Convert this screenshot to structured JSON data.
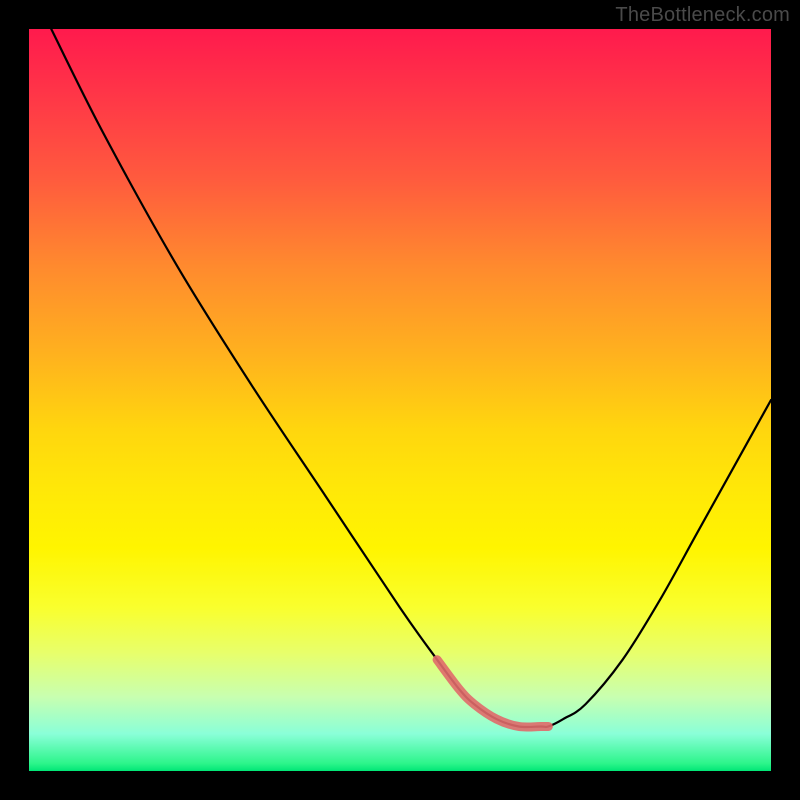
{
  "watermark": "TheBottleneck.com",
  "colors": {
    "frame": "#000000",
    "gradient_top": "#ff1a4d",
    "gradient_mid": "#ffe808",
    "gradient_bottom": "#00e676",
    "curve": "#000000",
    "highlight": "#e06a6a"
  },
  "chart_data": {
    "type": "line",
    "title": "",
    "xlabel": "",
    "ylabel": "",
    "xlim": [
      0,
      100
    ],
    "ylim": [
      0,
      100
    ],
    "series": [
      {
        "name": "bottleneck-curve",
        "x": [
          3,
          10,
          20,
          30,
          40,
          50,
          55,
          58,
          60,
          63,
          66,
          69,
          70,
          72,
          75,
          80,
          85,
          90,
          95,
          100
        ],
        "values": [
          100,
          86,
          68,
          52,
          37,
          22,
          15,
          11,
          9,
          7,
          6,
          6,
          6,
          7,
          9,
          15,
          23,
          32,
          41,
          50
        ]
      }
    ],
    "highlight_range_x": [
      55,
      70
    ],
    "annotations": []
  }
}
